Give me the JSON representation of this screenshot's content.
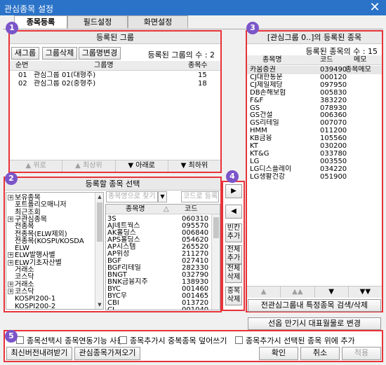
{
  "window": {
    "title": "관심종목 설정",
    "close_glyph": "✕"
  },
  "tabs": [
    "종목등록",
    "필드설정",
    "화면설정"
  ],
  "badges": [
    "1",
    "2",
    "3",
    "4",
    "5"
  ],
  "registered_groups": {
    "title": "등록된 그룹",
    "buttons": {
      "new": "새그룹",
      "delete": "그룹삭제",
      "rename": "그룹명변경"
    },
    "count_text": "등록된 그룹의 수 : 2",
    "columns": [
      "순번",
      "그룹명",
      "종목수"
    ],
    "rows": [
      {
        "no": "01",
        "name": "관심그룹 01(대형주)",
        "count": "15"
      },
      {
        "no": "02",
        "name": "관심그룹 02(중형주)",
        "count": "18"
      }
    ],
    "nav": [
      "▲ 위로",
      "▲ 최상위",
      "▼ 아래로",
      "▼ 최하위"
    ]
  },
  "stock_select": {
    "title": "등록할 종목 선택",
    "search_placeholder": "종목명으로 찾기",
    "code_placeholder": "코드로 등록",
    "tree": [
      {
        "label": "보유종목",
        "expander": "+",
        "indent": 0
      },
      {
        "label": "포트폴리오매니저",
        "expander": "",
        "indent": 1
      },
      {
        "label": "최근조회",
        "expander": "",
        "indent": 1
      },
      {
        "label": "구관심종목",
        "expander": "+",
        "indent": 0
      },
      {
        "label": "전종목",
        "expander": "",
        "indent": 1
      },
      {
        "label": "전종목(ELW제외)",
        "expander": "",
        "indent": 1
      },
      {
        "label": "전종목(KOSPI/KOSDA",
        "expander": "",
        "indent": 1
      },
      {
        "label": "ELW",
        "expander": "",
        "indent": 1
      },
      {
        "label": "ELW발행사별",
        "expander": "+",
        "indent": 0
      },
      {
        "label": "ELW기초자산별",
        "expander": "+",
        "indent": 0
      },
      {
        "label": "거래소",
        "expander": "",
        "indent": 1
      },
      {
        "label": "코스닥",
        "expander": "",
        "indent": 1
      },
      {
        "label": "거래소",
        "expander": "+",
        "indent": 0
      },
      {
        "label": "코스닥",
        "expander": "+",
        "indent": 0
      },
      {
        "label": "KOSPI200-1",
        "expander": "",
        "indent": 1
      },
      {
        "label": "KOSPI200-2",
        "expander": "",
        "indent": 1
      }
    ],
    "columns": [
      "종목명",
      "코드"
    ],
    "sort_glyph": "△",
    "rows": [
      {
        "name": "3S",
        "code": "060310"
      },
      {
        "name": "AJ네트웍스",
        "code": "095570"
      },
      {
        "name": "AK홀딩스",
        "code": "006840"
      },
      {
        "name": "APS홀딩스",
        "code": "054620"
      },
      {
        "name": "AP시스템",
        "code": "265520"
      },
      {
        "name": "AP위성",
        "code": "211270"
      },
      {
        "name": "BGF",
        "code": "027410"
      },
      {
        "name": "BGF리테일",
        "code": "282330"
      },
      {
        "name": "BNGT",
        "code": "032790"
      },
      {
        "name": "BNK금융지주",
        "code": "138930"
      },
      {
        "name": "BYC",
        "code": "001460"
      },
      {
        "name": "BYC우",
        "code": "001465"
      },
      {
        "name": "CBI",
        "code": "013720"
      },
      {
        "name": "CJ",
        "code": "001040"
      }
    ]
  },
  "transfer": {
    "add": "▶",
    "remove": "◀",
    "blank_add": "빈칸\n추가",
    "all_add": "전체\n추가",
    "all_delete": "전체\n삭제",
    "dup_delete": "중복\n삭제"
  },
  "group_stocks": {
    "title": "[관심그룹 0..]의 등록된 종목",
    "count_text": "등록된 종목의 수 : 15",
    "columns": [
      "종목명",
      "코드",
      "메모"
    ],
    "rows": [
      {
        "name": "카움증권",
        "code": "039490",
        "memo": "종목메모"
      },
      {
        "name": "CJ대한통운",
        "code": "000120",
        "memo": ""
      },
      {
        "name": "CJ제일제당",
        "code": "097950",
        "memo": ""
      },
      {
        "name": "DB손해보험",
        "code": "005830",
        "memo": ""
      },
      {
        "name": "F&F",
        "code": "383220",
        "memo": ""
      },
      {
        "name": "GS",
        "code": "078930",
        "memo": ""
      },
      {
        "name": "GS건설",
        "code": "006360",
        "memo": ""
      },
      {
        "name": "GS리테일",
        "code": "007070",
        "memo": ""
      },
      {
        "name": "HMM",
        "code": "011200",
        "memo": ""
      },
      {
        "name": "KB금융",
        "code": "105560",
        "memo": ""
      },
      {
        "name": "KT",
        "code": "030200",
        "memo": ""
      },
      {
        "name": "KT&G",
        "code": "033780",
        "memo": ""
      },
      {
        "name": "LG",
        "code": "003550",
        "memo": ""
      },
      {
        "name": "LG디스플레이",
        "code": "034220",
        "memo": ""
      },
      {
        "name": "LG생활건강",
        "code": "051900",
        "memo": ""
      }
    ],
    "nav": [
      "▲",
      "▲▲",
      "▼",
      "▼▼"
    ],
    "search_other": "전관심그룹내 특정종목 검색/삭제",
    "rep_change": "선옵 만기시 대표월물로 변경"
  },
  "options": {
    "link_on_select": "종목선택시 종목연동기능 사용",
    "overwrite_dup": "종목추가시 중복종목 덮어쓰기",
    "add_above": "종목추가시 선택된 종목 위에 추가"
  },
  "footer": {
    "download_latest": "최신버전내려받기",
    "import": "관심종목가져오기",
    "ok": "확인",
    "cancel": "취소",
    "apply": "적용"
  }
}
